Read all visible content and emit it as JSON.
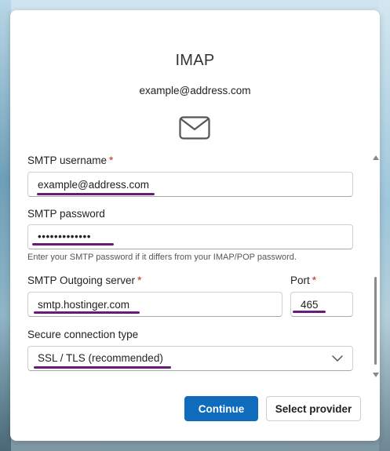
{
  "dialog": {
    "title": "IMAP",
    "account_email": "example@address.com"
  },
  "fields": {
    "smtp_username": {
      "label": "SMTP username",
      "required_mark": "*",
      "value": "example@address.com"
    },
    "smtp_password": {
      "label": "SMTP password",
      "value": "•••••••••••••",
      "hint": "Enter your SMTP password if it differs from your IMAP/POP password."
    },
    "smtp_server": {
      "label": "SMTP Outgoing server",
      "required_mark": "*",
      "value": "smtp.hostinger.com"
    },
    "port": {
      "label": "Port",
      "required_mark": "*",
      "value": "465"
    },
    "connection_type": {
      "label": "Secure connection type",
      "selected": "SSL / TLS (recommended)"
    }
  },
  "buttons": {
    "continue_label": "Continue",
    "select_provider_label": "Select provider"
  },
  "colors": {
    "accent": "#0f6cbd",
    "required": "#c42b1c",
    "annotation_underline": "#6a1b7a"
  },
  "icons": {
    "mail": "mail-envelope-icon",
    "chevron": "chevron-down-icon"
  }
}
